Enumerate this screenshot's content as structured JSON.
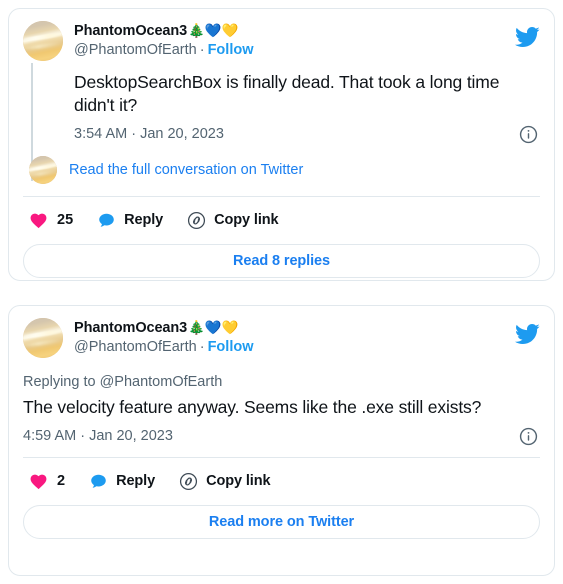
{
  "page": {
    "background_color": "#ffffff",
    "accent_color": "#1d9bf0",
    "link_color": "#1b7ff0",
    "like_color": "#f91880",
    "text_color": "#0f1419",
    "muted_color": "#536471",
    "border_color": "#e1e8ed"
  },
  "tweets": [
    {
      "id": "tweet-1",
      "author": {
        "display_name": "PhantomOcean3",
        "name_emojis": "🎄💙💛",
        "handle": "@PhantomOfEarth",
        "separator": "·",
        "follow_label": "Follow",
        "avatar_name": "saturn-planet-avatar"
      },
      "text": "DesktopSearchBox is finally dead. That took a long time didn't it?",
      "timestamp": "3:54 AM · Jan 20, 2023",
      "info_icon": "info-circle-icon",
      "brand_icon": "twitter-bird-icon",
      "conversation_link": "Read the full conversation on Twitter",
      "actions": {
        "like_count": "25",
        "like_icon": "heart-icon",
        "reply_label": "Reply",
        "reply_icon": "speech-bubble-icon",
        "copy_label": "Copy link",
        "copy_icon": "link-chain-icon"
      },
      "cta_label": "Read 8 replies"
    },
    {
      "id": "tweet-2",
      "author": {
        "display_name": "PhantomOcean3",
        "name_emojis": "🎄💙💛",
        "handle": "@PhantomOfEarth",
        "separator": "·",
        "follow_label": "Follow",
        "avatar_name": "saturn-planet-avatar"
      },
      "replying_to": "Replying to @PhantomOfEarth",
      "text": "The velocity feature anyway. Seems like the .exe still exists?",
      "timestamp": "4:59 AM · Jan 20, 2023",
      "info_icon": "info-circle-icon",
      "brand_icon": "twitter-bird-icon",
      "actions": {
        "like_count": "2",
        "like_icon": "heart-icon",
        "reply_label": "Reply",
        "reply_icon": "speech-bubble-icon",
        "copy_label": "Copy link",
        "copy_icon": "link-chain-icon"
      },
      "cta_label": "Read more on Twitter"
    }
  ]
}
